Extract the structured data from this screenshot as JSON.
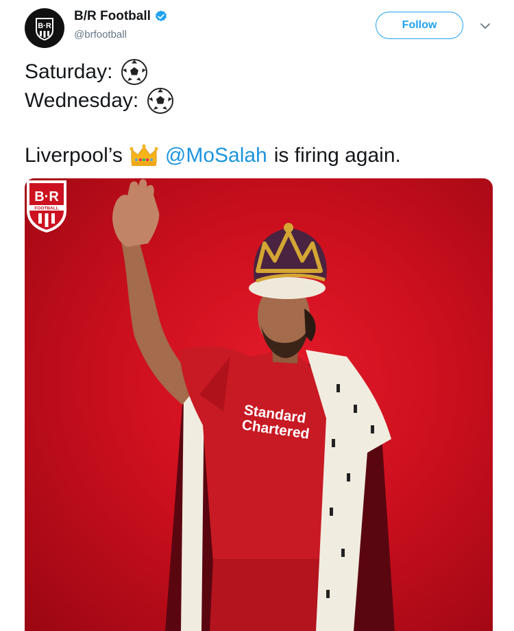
{
  "account": {
    "display_name": "B/R Football",
    "handle": "@brfootball",
    "avatar_icon": "br-football-logo",
    "verified_icon": "verified-badge-icon",
    "accent_color": "#1da1f2"
  },
  "actions": {
    "follow_label": "Follow",
    "more_icon": "chevron-down-icon"
  },
  "tweet": {
    "line1": "Saturday:",
    "line2": "Wednesday:",
    "line1_icon": "soccer-ball-emoji",
    "line2_icon": "soccer-ball-emoji",
    "line3_before": "Liverpool’s",
    "line3_icon": "crown-emoji",
    "mention": "@MoSalah",
    "line3_after": "is firing again.",
    "mention_color": "#1b95e0"
  },
  "media": {
    "background_color": "#d3101f",
    "logo_icon": "br-football-logo",
    "logo_text": "B·R",
    "logo_subtext": "FOOTBALL",
    "shirt_sponsor_line1": "Standard",
    "shirt_sponsor_line2": "Chartered"
  }
}
